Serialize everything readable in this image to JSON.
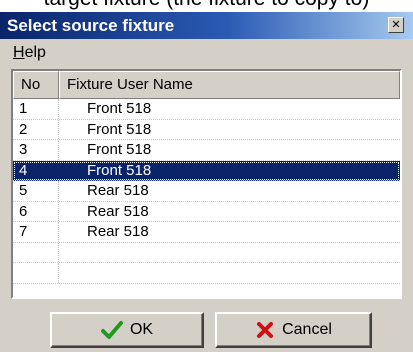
{
  "caption": "target fixture (the fixture to copy to)",
  "dialog": {
    "title": "Select source fixture",
    "close_glyph": "✕",
    "menu": {
      "help_mnemonic": "H",
      "help_rest": "elp"
    },
    "columns": {
      "no": "No",
      "name": "Fixture User Name"
    },
    "rows": [
      {
        "no": "1",
        "name": "Front 518",
        "selected": false
      },
      {
        "no": "2",
        "name": "Front 518",
        "selected": false
      },
      {
        "no": "3",
        "name": "Front 518",
        "selected": false
      },
      {
        "no": "4",
        "name": "Front 518",
        "selected": true
      },
      {
        "no": "5",
        "name": "Rear 518",
        "selected": false
      },
      {
        "no": "6",
        "name": "Rear 518",
        "selected": false
      },
      {
        "no": "7",
        "name": "Rear 518",
        "selected": false
      },
      {
        "no": "",
        "name": "",
        "selected": false
      },
      {
        "no": "",
        "name": "",
        "selected": false
      }
    ],
    "buttons": {
      "ok": {
        "label": "OK",
        "icon": "checkmark-icon",
        "icon_color": "#1e9a1e"
      },
      "cancel": {
        "label": "Cancel",
        "icon": "x-icon",
        "icon_color": "#d01010"
      }
    },
    "colors": {
      "title_bar_start": "#0a246a",
      "title_bar_end": "#a6caf0",
      "selection": "#0a246a",
      "face": "#d4d0c8"
    }
  }
}
